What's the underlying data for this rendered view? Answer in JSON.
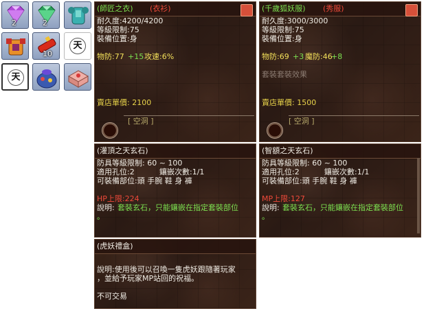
{
  "inventory": {
    "slots": [
      {
        "name": "purple-gem",
        "qty": "2"
      },
      {
        "name": "green-gem",
        "qty": "2"
      },
      {
        "name": "teal-armor",
        "qty": ""
      },
      {
        "name": "orange-armor",
        "qty": ""
      },
      {
        "name": "red-firecracker",
        "qty": "10"
      },
      {
        "name": "tian-stone",
        "qty": "",
        "glyph": "天"
      },
      {
        "name": "tian-stone-white",
        "qty": "",
        "glyph": "天"
      },
      {
        "name": "blue-bag",
        "qty": ""
      },
      {
        "name": "pink-gift-box",
        "qty": ""
      }
    ]
  },
  "tooltips": {
    "master_robe": {
      "title": "(師匠之衣)",
      "tag": "(衣衫)",
      "durability": "耐久度:4200/4200",
      "level_limit": "等級限制:75",
      "slot": "裝備位置:身",
      "stat_prefix": "物防:77",
      "stat_bonus": "+15",
      "stat_speed": "攻速:6%",
      "price": "賣店單價: 2100",
      "socket": "[ 空洞 ]"
    },
    "fox_robe": {
      "title": "(千歲狐妖服)",
      "tag": "(秀服)",
      "durability": "耐久度:3000/3000",
      "level_limit": "等級限制:75",
      "slot": "裝備位置:身",
      "stat_pdef": "物防:69",
      "stat_pdef_bonus": "+3",
      "stat_mdef": "魔防:46",
      "stat_mdef_bonus": "+8",
      "faded": "套裝套裝效果",
      "price": "賣店單價: 1500",
      "socket": "[ 空洞 ]"
    },
    "guanding_stone": {
      "title": "(灌頂之天玄石)",
      "req": "防具等級限制: 60 ~ 100",
      "holes": "適用孔位:2",
      "inlay": "鑲嵌次數:1/1",
      "parts": "可裝備部位:頭 手腕 鞋 身 褲",
      "stat": "HP上限:224",
      "desc_label": "說明:",
      "desc": "套裝玄石，只能鑲嵌在指定套裝部位",
      "desc_end": "。"
    },
    "zhiling_stone": {
      "title": "(智額之天玄石)",
      "req": "防具等級限制: 60 ~ 100",
      "holes": "適用孔位:2",
      "inlay": "鑲嵌次數:1/1",
      "parts": "可裝備部位:頭 手腕 鞋 身 褲",
      "stat": "MP上限:127",
      "desc_label": "說明:",
      "desc": "套裝玄石，只能鑲嵌在指定套裝部位",
      "desc_end": "。"
    },
    "tiger_gift": {
      "title": "(虎妖禮盒)",
      "desc1": "說明:使用後可以召喚一隻虎妖跟隨著玩家",
      "desc2": "，並給予玩家MP站回的祝福。",
      "trade": "不可交易"
    }
  },
  "colors": {
    "panel_bg": "#2e1c15",
    "green": "#7ce050",
    "yellow": "#f3e05a",
    "red": "#f04a3a"
  }
}
